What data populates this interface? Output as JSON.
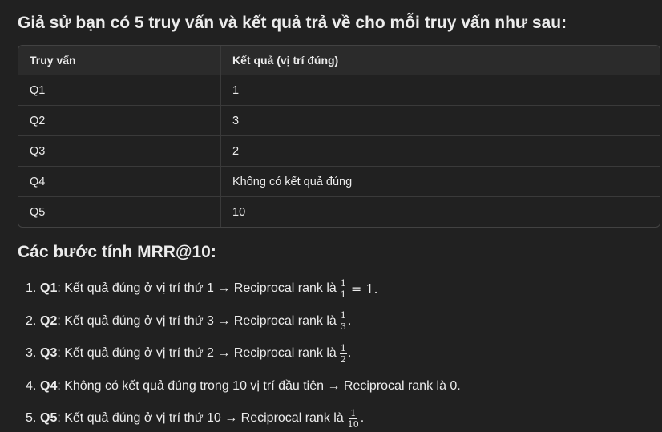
{
  "heading_intro": "Giả sử bạn có 5 truy vấn và kết quả trả về cho mỗi truy vấn như sau:",
  "table": {
    "headers": [
      "Truy vấn",
      "Kết quả (vị trí đúng)"
    ],
    "rows": [
      [
        "Q1",
        "1"
      ],
      [
        "Q2",
        "3"
      ],
      [
        "Q3",
        "2"
      ],
      [
        "Q4",
        "Không có kết quả đúng"
      ],
      [
        "Q5",
        "10"
      ]
    ]
  },
  "heading_steps": "Các bước tính MRR@10:",
  "steps": [
    {
      "num": "1.",
      "q": "Q1",
      "text": ": Kết quả đúng ở vị trí thứ 1 → Reciprocal rank là ",
      "frac_num": "1",
      "frac_den": "1",
      "tail": "= 1."
    },
    {
      "num": "2.",
      "q": "Q2",
      "text": ": Kết quả đúng ở vị trí thứ 3 → Reciprocal rank là ",
      "frac_num": "1",
      "frac_den": "3",
      "tail": "."
    },
    {
      "num": "3.",
      "q": "Q3",
      "text": ": Kết quả đúng ở vị trí thứ 2 → Reciprocal rank là ",
      "frac_num": "1",
      "frac_den": "2",
      "tail": "."
    },
    {
      "num": "4.",
      "q": "Q4",
      "text": ": Không có kết quả đúng trong 10 vị trí đầu tiên → Reciprocal rank là 0."
    },
    {
      "num": "5.",
      "q": "Q5",
      "text": ": Kết quả đúng ở vị trí thứ 10 → Reciprocal rank là ",
      "frac_num": "1",
      "frac_den": "10",
      "tail": "."
    }
  ]
}
